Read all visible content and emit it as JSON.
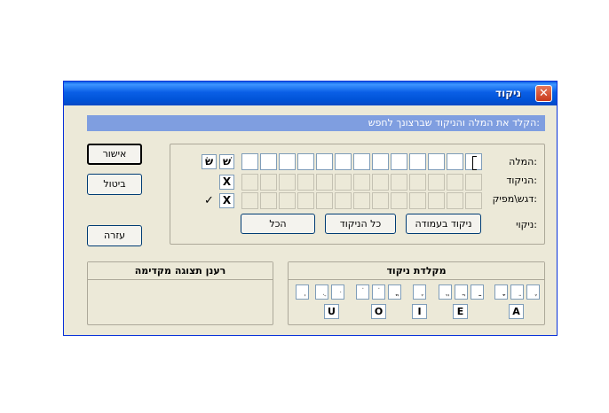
{
  "window": {
    "title": "ניקוד",
    "close": "✕"
  },
  "instruction": "הקלד את המלה והניקוד שברצונך לחפש:",
  "buttons": {
    "ok": "אישור",
    "cancel": "ביטול",
    "help": "עזרה"
  },
  "fields": {
    "word": "המלה:",
    "niqqud": "הניקוד:",
    "dagesh": "דגש\\מפיק:",
    "niqqui": "ניקוי:"
  },
  "niqqui_buttons": {
    "column": "ניקוד בעמודה",
    "all_niqqud": "כל הניקוד",
    "all": "הכל"
  },
  "side_icons": {
    "shin_dot_right": "שׁ",
    "shin_dot_left": "שׂ",
    "x1": "X",
    "x2": "X",
    "check": "✓"
  },
  "keyboard": {
    "title": "מקלדת ניקוד",
    "keys": [
      "ֶ",
      "ֵ",
      "ָ",
      "ַ",
      "ֲ",
      "ֱ",
      "ֶ",
      "ֳ",
      "ֹ",
      "ֹ",
      "ּ",
      "ֻ",
      "ְ"
    ],
    "vowels": [
      "A",
      "E",
      "I",
      "O",
      "U"
    ]
  },
  "preview": {
    "title": "רענן תצוגה מקדימה"
  }
}
